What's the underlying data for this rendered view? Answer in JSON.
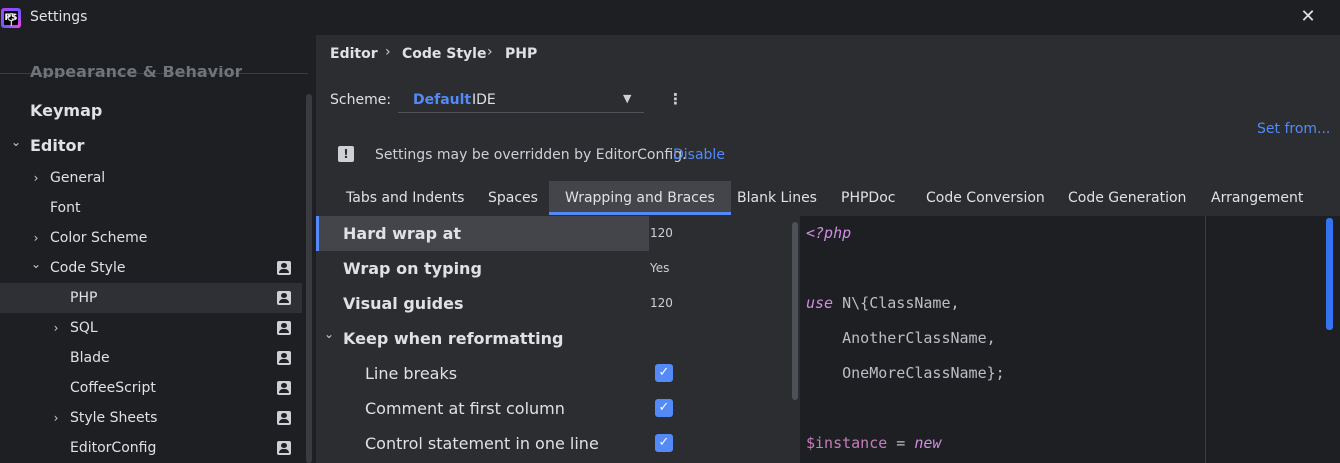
{
  "window": {
    "title": "Settings",
    "logo_text": "PS",
    "close_glyph": "✕"
  },
  "search": {
    "icon": "search-icon",
    "placeholder": ""
  },
  "tree": {
    "cut_item": "Appearance & Behavior",
    "items": [
      {
        "label": "Keymap",
        "bold": true
      },
      {
        "label": "Editor",
        "bold": true,
        "expanded": true
      },
      {
        "label": "General",
        "chevron": "›"
      },
      {
        "label": "Font"
      },
      {
        "label": "Color Scheme",
        "chevron": "›"
      },
      {
        "label": "Code Style",
        "chevron": "⌄",
        "expanded": true
      },
      {
        "label": "PHP",
        "selected": true
      },
      {
        "label": "SQL",
        "chevron": "›"
      },
      {
        "label": "Blade"
      },
      {
        "label": "CoffeeScript"
      },
      {
        "label": "Style Sheets",
        "chevron": "›"
      },
      {
        "label": "EditorConfig"
      }
    ]
  },
  "breadcrumb": {
    "items": [
      "Editor",
      "Code Style",
      "PHP"
    ],
    "separator": "›"
  },
  "scheme": {
    "label": "Scheme:",
    "name": "Default",
    "type": "IDE",
    "arrow": "▼",
    "more": "⋮"
  },
  "set_from": "Set from...",
  "notice": {
    "icon": "!",
    "text": "Settings may be overridden by EditorConfig.",
    "link": "Disable"
  },
  "tabs": [
    {
      "label": "Tabs and Indents"
    },
    {
      "label": "Spaces"
    },
    {
      "label": "Wrapping and Braces",
      "active": true
    },
    {
      "label": "Blank Lines"
    },
    {
      "label": "PHPDoc"
    },
    {
      "label": "Code Conversion"
    },
    {
      "label": "Code Generation"
    },
    {
      "label": "Arrangement"
    }
  ],
  "options": [
    {
      "label": "Hard wrap at",
      "value": "120",
      "selected": true
    },
    {
      "label": "Wrap on typing",
      "value": "Yes"
    },
    {
      "label": "Visual guides",
      "value": "120"
    },
    {
      "label": "Keep when reformatting",
      "group": true
    },
    {
      "label": "Line breaks",
      "checked": true
    },
    {
      "label": "Comment at first column",
      "checked": true
    },
    {
      "label": "Control statement in one line",
      "checked": true
    }
  ],
  "preview": {
    "lines": [
      {
        "parts": [
          {
            "t": "<?php",
            "c": "kw"
          }
        ]
      },
      {
        "parts": []
      },
      {
        "parts": [
          {
            "t": "use",
            "c": "kw"
          },
          {
            "t": " N\\{ClassName,",
            "c": "op"
          }
        ]
      },
      {
        "parts": [
          {
            "t": "    AnotherClassName,",
            "c": "op"
          }
        ]
      },
      {
        "parts": [
          {
            "t": "    OneMoreClassName};",
            "c": "op"
          }
        ]
      },
      {
        "parts": []
      },
      {
        "parts": [
          {
            "t": "$instance",
            "c": "var"
          },
          {
            "t": " = ",
            "c": "op"
          },
          {
            "t": "new",
            "c": "kw"
          }
        ]
      }
    ]
  },
  "colors": {
    "accent": "#548af7",
    "background": "#1e1f22",
    "panel": "#2b2d30"
  }
}
